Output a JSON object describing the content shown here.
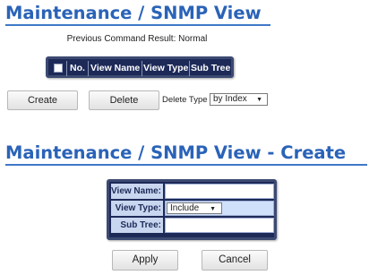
{
  "list_view": {
    "title": "Maintenance / SNMP View",
    "command_result": "Previous Command Result: Normal",
    "table": {
      "columns": [
        "No.",
        "View Name",
        "View Type",
        "Sub Tree"
      ]
    },
    "create_label": "Create",
    "delete_label": "Delete",
    "delete_type_label": "Delete Type",
    "delete_type_value": "by Index",
    "caret": "▼"
  },
  "create_view": {
    "title": "Maintenance / SNMP View - Create",
    "fields": {
      "view_name_label": "View Name:",
      "view_name_value": "",
      "view_type_label": "View Type:",
      "view_type_value": "Include",
      "sub_tree_label": "Sub Tree:",
      "sub_tree_value": ""
    },
    "apply_label": "Apply",
    "cancel_label": "Cancel",
    "caret": "▼"
  },
  "colors": {
    "title_blue": "#2a63b8",
    "table_header_bg": "#1d2a58",
    "form_label_bg": "#c9d6ef"
  }
}
